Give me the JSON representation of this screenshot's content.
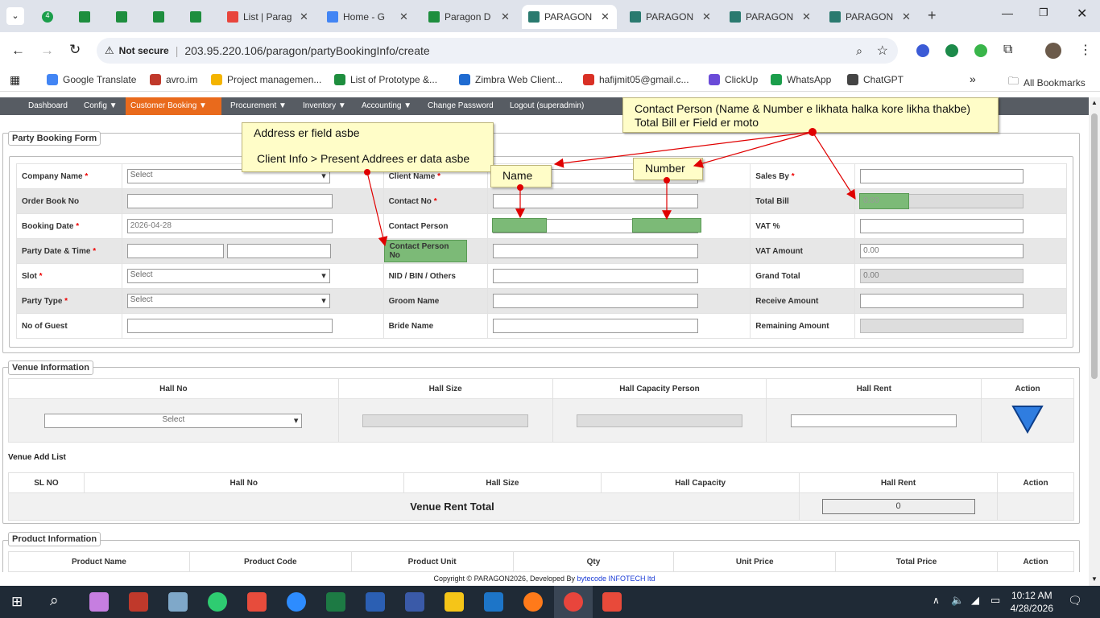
{
  "browser": {
    "tabs": [
      {
        "label": "",
        "badge": "4"
      },
      {
        "label": ""
      },
      {
        "label": ""
      },
      {
        "label": ""
      },
      {
        "label": ""
      },
      {
        "label": "List | Parag"
      },
      {
        "label": "Home - G"
      },
      {
        "label": "Paragon D"
      },
      {
        "label": "PARAGON"
      },
      {
        "label": "PARAGON"
      },
      {
        "label": "PARAGON"
      },
      {
        "label": "PARAGON"
      }
    ],
    "security_label": "Not secure",
    "url": "203.95.220.106/paragon/partyBookingInfo/create",
    "bookmarks": [
      "Google Translate",
      "avro.im",
      "Project managemen...",
      "List of Prototype &...",
      "Zimbra Web Client...",
      "hafijmit05@gmail.c...",
      "ClickUp",
      "WhatsApp",
      "ChatGPT"
    ],
    "all_bookmarks": "All Bookmarks"
  },
  "nav": {
    "items": [
      "Dashboard",
      "Config ▼",
      "Customer Booking ▼",
      "Procurement ▼",
      "Inventory ▼",
      "Accounting ▼",
      "Change Password",
      "Logout (superadmin)"
    ]
  },
  "party_form": {
    "legend": "Party Booking Form",
    "col1": [
      {
        "label": "Company Name",
        "req": "*",
        "type": "select",
        "value": "Select"
      },
      {
        "label": "Order Book No",
        "req": "",
        "type": "input",
        "value": ""
      },
      {
        "label": "Booking Date",
        "req": "*",
        "type": "input",
        "value": "2026-04-28"
      },
      {
        "label": "Party Date & Time",
        "req": "*",
        "type": "double",
        "value": ""
      },
      {
        "label": "Slot",
        "req": "*",
        "type": "select",
        "value": "Select"
      },
      {
        "label": "Party Type",
        "req": "*",
        "type": "select",
        "value": "Select"
      },
      {
        "label": "No of Guest",
        "req": "",
        "type": "input",
        "value": ""
      }
    ],
    "col2": [
      {
        "label": "Client Name",
        "req": "*"
      },
      {
        "label": "Contact No",
        "req": "*"
      },
      {
        "label": "Contact Person",
        "req": ""
      },
      {
        "label": "Contact Person No",
        "req": ""
      },
      {
        "label": "NID / BIN / Others",
        "req": ""
      },
      {
        "label": "Groom Name",
        "req": ""
      },
      {
        "label": "Bride Name",
        "req": ""
      }
    ],
    "col3": [
      {
        "label": "Sales By",
        "req": "*",
        "value": "",
        "ro": false
      },
      {
        "label": "Total Bill",
        "req": "",
        "value": "0.00",
        "ro": true
      },
      {
        "label": "VAT %",
        "req": "",
        "value": "",
        "ro": false
      },
      {
        "label": "VAT Amount",
        "req": "",
        "value": "0.00",
        "ro": false
      },
      {
        "label": "Grand Total",
        "req": "",
        "value": "0.00",
        "ro": true
      },
      {
        "label": "Receive Amount",
        "req": "",
        "value": "",
        "ro": false
      },
      {
        "label": "Remaining Amount",
        "req": "",
        "value": "",
        "ro": true
      }
    ]
  },
  "venue": {
    "legend": "Venue Information",
    "headers": [
      "Hall No",
      "Hall Size",
      "Hall Capacity Person",
      "Hall Rent",
      "Action"
    ],
    "hall_select": "Select",
    "add_list_title": "Venue Add List",
    "list_headers": [
      "SL NO",
      "Hall No",
      "Hall Size",
      "Hall Capacity",
      "Hall Rent",
      "Action"
    ],
    "total_label": "Venue Rent Total",
    "total_value": "0"
  },
  "product": {
    "legend": "Product Information",
    "headers": [
      "Product Name",
      "Product Code",
      "Product Unit",
      "Qty",
      "Unit Price",
      "Total Price",
      "Action"
    ]
  },
  "footer": {
    "text": "Copyright © PARAGON2026, Developed By ",
    "link": "bytecode INFOTECH ltd"
  },
  "annotations": {
    "address_line1": "Address er field asbe",
    "address_line2": "Client Info > Present Addrees er data asbe",
    "name": "Name",
    "number": "Number",
    "contact_line1": "Contact Person (Name & Number e likhata halka kore likha thakbe)",
    "contact_line2": "Total Bill er Field er moto"
  },
  "taskbar": {
    "time": "10:12 AM",
    "date": "4/28/2026"
  },
  "colors": {
    "nav_bg": "#575c63",
    "nav_active": "#e96a1c",
    "highlight": "#7cba77",
    "note_bg": "#fffdc8",
    "arrow": "#e00000"
  }
}
